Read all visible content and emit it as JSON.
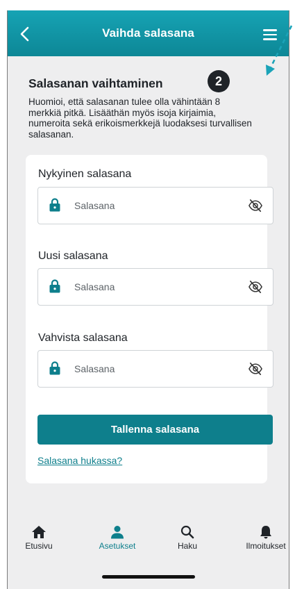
{
  "header": {
    "title": "Vaihda salasana"
  },
  "section": {
    "title": "Salasanan vaihtaminen",
    "step_badge": "2",
    "info_lines": [
      "Huomioi, että salasanan tulee olla vähintään 8",
      "merkkiä pitkä. Lisääthän myös isoja kirjaimia,",
      "numeroita sekä erikoismerkkejä luodaksesi turvallisen",
      "salasanan."
    ]
  },
  "form": {
    "fields": [
      {
        "label": "Nykyinen salasana",
        "placeholder": "Salasana",
        "value": ""
      },
      {
        "label": "Uusi salasana",
        "placeholder": "Salasana",
        "value": ""
      },
      {
        "label": "Vahvista salasana",
        "placeholder": "Salasana",
        "value": ""
      }
    ],
    "save_label": "Tallenna salasana",
    "forgot_label": "Salasana hukassa?"
  },
  "tabbar": {
    "items": [
      {
        "label": "Etusivu",
        "icon": "home-icon",
        "active": false
      },
      {
        "label": "Asetukset",
        "icon": "user-icon",
        "active": true
      },
      {
        "label": "Haku",
        "icon": "search-icon",
        "active": false
      },
      {
        "label": "Ilmoitukset",
        "icon": "bell-icon",
        "active": false
      }
    ]
  },
  "colors": {
    "brand": "#0e7f8c",
    "header_gradient_top": "#16a3b4",
    "background": "#eeeeef",
    "annotation_arrow": "#1aa3b8"
  }
}
